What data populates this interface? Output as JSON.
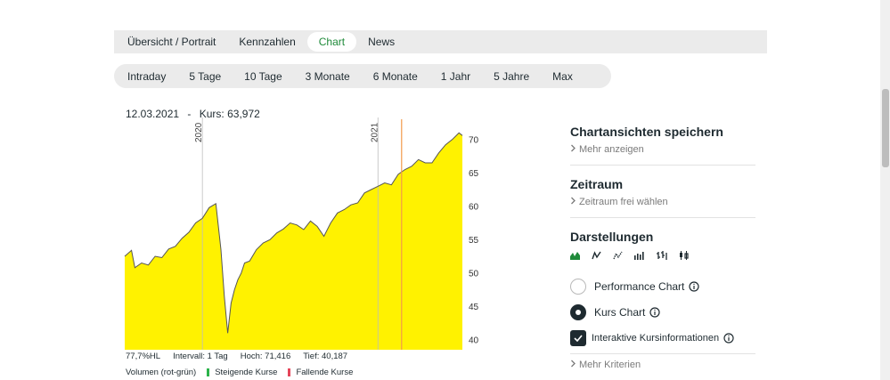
{
  "tabs": [
    {
      "label": "Übersicht / Portrait",
      "active": false
    },
    {
      "label": "Kennzahlen",
      "active": false
    },
    {
      "label": "Chart",
      "active": true
    },
    {
      "label": "News",
      "active": false
    }
  ],
  "ranges": [
    "Intraday",
    "5 Tage",
    "10 Tage",
    "3 Monate",
    "6 Monate",
    "1 Jahr",
    "5 Jahre",
    "Max"
  ],
  "quote": {
    "date": "12.03.2021",
    "separator": "-",
    "price_text": "Kurs: 63,972"
  },
  "stats": {
    "hl": "77,7%HL",
    "interval": "Intervall: 1 Tag",
    "high": "Hoch:  71,416",
    "low": "Tief:  40,187"
  },
  "legend": {
    "volume": "Volumen (rot-grün)",
    "rising": "Steigende Kurse",
    "falling": "Fallende Kurse",
    "rising_color": "#2bb34a",
    "falling_color": "#e5455a"
  },
  "sidebar": {
    "save_title": "Chartansichten speichern",
    "save_more": "Mehr anzeigen",
    "period_title": "Zeitraum",
    "period_link": "Zeitraum frei wählen",
    "display_title": "Darstellungen",
    "display_icons": [
      "mountain-chart-icon",
      "line-chart-icon",
      "dotted-line-chart-icon",
      "bar-chart-icon",
      "ohlc-chart-icon",
      "candlestick-chart-icon"
    ],
    "performance_label": "Performance Chart",
    "performance_checked": false,
    "kurs_label": "Kurs Chart",
    "kurs_checked": true,
    "interactive_label": "Interaktive Kursinformationen",
    "interactive_checked": true,
    "more_criteria": "Mehr Kriterien"
  },
  "chart_data": {
    "type": "area",
    "fill_color": "#fff200",
    "line_color": "#555555",
    "marker_line_color": "#f29a4a",
    "y_ticks": [
      40,
      45,
      50,
      55,
      60,
      65,
      70
    ],
    "ylim": [
      38.5,
      72.5
    ],
    "year_labels": [
      "2020",
      "2021"
    ],
    "year_positions_t": [
      0.23,
      0.75
    ],
    "marker_t": 0.82,
    "points_t": [
      0,
      0.02,
      0.03,
      0.05,
      0.07,
      0.09,
      0.11,
      0.13,
      0.15,
      0.17,
      0.19,
      0.21,
      0.23,
      0.25,
      0.27,
      0.285,
      0.295,
      0.305,
      0.315,
      0.325,
      0.335,
      0.345,
      0.355,
      0.37,
      0.39,
      0.41,
      0.43,
      0.45,
      0.47,
      0.49,
      0.51,
      0.53,
      0.55,
      0.57,
      0.59,
      0.61,
      0.63,
      0.65,
      0.67,
      0.69,
      0.71,
      0.73,
      0.75,
      0.77,
      0.79,
      0.81,
      0.83,
      0.85,
      0.87,
      0.89,
      0.91,
      0.93,
      0.95,
      0.97,
      0.99,
      1.0
    ],
    "values": [
      52.5,
      53.4,
      50.8,
      51.5,
      51.2,
      52.5,
      52.3,
      53.6,
      54.0,
      55.2,
      56.1,
      57.5,
      58.2,
      59.8,
      60.4,
      53.5,
      46.5,
      41.0,
      45.5,
      47.5,
      49.0,
      50.0,
      51.5,
      51.8,
      53.5,
      54.5,
      55.0,
      56.0,
      56.6,
      57.5,
      57.2,
      56.5,
      57.8,
      57.0,
      55.5,
      57.5,
      59.0,
      59.5,
      60.2,
      60.5,
      62.0,
      62.5,
      63.0,
      63.5,
      63.2,
      64.8,
      65.5,
      66.0,
      67.0,
      66.5,
      66.5,
      68.0,
      69.2,
      70.0,
      71.0,
      70.6
    ]
  }
}
